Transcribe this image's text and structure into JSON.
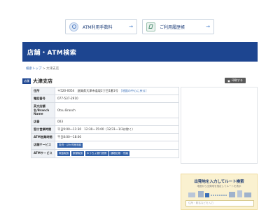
{
  "top_buttons": {
    "atm_fee": "ATM利用手数料",
    "history": "ご利用履歴帳"
  },
  "banner": {
    "title": "店舗・ATM検索"
  },
  "breadcrumb": {
    "top": "検索トップ",
    "sep": ">",
    "current": "大津支店"
  },
  "branch": {
    "tag": "店舗",
    "name": "大津支店",
    "print": "印刷する"
  },
  "table": {
    "address": {
      "label": "住所",
      "value": "〒520-0054　滋賀県大津市逢坂2丁目1番1号",
      "map": "［地図の中心に戻る］"
    },
    "phone": {
      "label": "電話番号",
      "value": "077-537-2910"
    },
    "english_name": {
      "label": "英文店舗名/Branch Name",
      "value": "Otsu Branch"
    },
    "branch_no": {
      "label": "店番",
      "value": "003"
    },
    "window_hours": {
      "label": "窓口営業時間",
      "value": "平日9:00～11:30　12:30～15:00（12/31～1/3は除く）"
    },
    "atm_hours": {
      "label": "ATM営業時間",
      "value": "平日8:00～18:00"
    },
    "store_services": {
      "label": "店舗サービス",
      "chips": [
        "投資・ほか資産相談"
      ]
    },
    "atm_services": {
      "label": "ATMサービス",
      "chips": [
        "現金取扱",
        "振替取扱",
        "ゆうちょ銀行提携",
        "通帳記帳・残高"
      ]
    }
  },
  "route": {
    "title": "出発地を入力してルート検索",
    "sub": "地図から出発地を指定してルートを表示",
    "placeholder": "住所・駅名などを入力"
  },
  "colors": {
    "brand": "#1d4590",
    "link": "#3a6fb8",
    "route_bg": "#faf1d0"
  }
}
